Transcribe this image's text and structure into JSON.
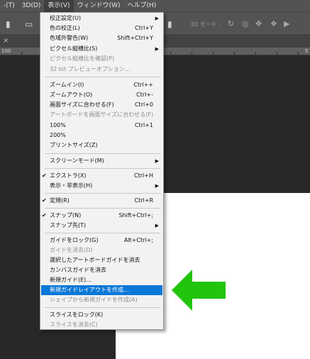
{
  "menubar": {
    "items": [
      "-(T)",
      "3D(D)",
      "表示(V)",
      "ウィンドウ(W)",
      "ヘルプ(H)"
    ]
  },
  "optionsbar": {
    "mode_label": "3D モード :"
  },
  "ruler": {
    "marks": [
      "100",
      "5"
    ]
  },
  "menu": {
    "items": [
      {
        "label": "校正設定(U)",
        "shortcut": "",
        "submenu": true,
        "checked": false,
        "disabled": false
      },
      {
        "label": "色の校正(L)",
        "shortcut": "Ctrl+Y",
        "submenu": false,
        "checked": false,
        "disabled": false
      },
      {
        "label": "色域外警告(W)",
        "shortcut": "Shift+Ctrl+Y",
        "submenu": false,
        "checked": false,
        "disabled": false
      },
      {
        "label": "ピクセル縦横比(S)",
        "shortcut": "",
        "submenu": true,
        "checked": false,
        "disabled": false
      },
      {
        "label": "ピクセル縦横比を確認(P)",
        "shortcut": "",
        "submenu": false,
        "checked": false,
        "disabled": true
      },
      {
        "label": "32 bit プレビューオプション...",
        "shortcut": "",
        "submenu": false,
        "checked": false,
        "disabled": true
      },
      {
        "label": "ズームイン(I)",
        "shortcut": "Ctrl++",
        "submenu": false,
        "checked": false,
        "disabled": false
      },
      {
        "label": "ズームアウト(O)",
        "shortcut": "Ctrl+-",
        "submenu": false,
        "checked": false,
        "disabled": false
      },
      {
        "label": "画面サイズに合わせる(F)",
        "shortcut": "Ctrl+0",
        "submenu": false,
        "checked": false,
        "disabled": false
      },
      {
        "label": "アートボードを画面サイズに合わせる(F)",
        "shortcut": "",
        "submenu": false,
        "checked": false,
        "disabled": true
      },
      {
        "label": "100%",
        "shortcut": "Ctrl+1",
        "submenu": false,
        "checked": false,
        "disabled": false
      },
      {
        "label": "200%",
        "shortcut": "",
        "submenu": false,
        "checked": false,
        "disabled": false
      },
      {
        "label": "プリントサイズ(Z)",
        "shortcut": "",
        "submenu": false,
        "checked": false,
        "disabled": false
      },
      {
        "label": "スクリーンモード(M)",
        "shortcut": "",
        "submenu": true,
        "checked": false,
        "disabled": false
      },
      {
        "label": "エクストラ(X)",
        "shortcut": "Ctrl+H",
        "submenu": false,
        "checked": true,
        "disabled": false
      },
      {
        "label": "表示・非表示(H)",
        "shortcut": "",
        "submenu": true,
        "checked": false,
        "disabled": false
      },
      {
        "label": "定規(R)",
        "shortcut": "Ctrl+R",
        "submenu": false,
        "checked": true,
        "disabled": false
      },
      {
        "label": "スナップ(N)",
        "shortcut": "Shift+Ctrl+;",
        "submenu": false,
        "checked": true,
        "disabled": false
      },
      {
        "label": "スナップ先(T)",
        "shortcut": "",
        "submenu": true,
        "checked": false,
        "disabled": false
      },
      {
        "label": "ガイドをロック(G)",
        "shortcut": "Alt+Ctrl+;",
        "submenu": false,
        "checked": false,
        "disabled": false
      },
      {
        "label": "ガイドを消去(D)",
        "shortcut": "",
        "submenu": false,
        "checked": false,
        "disabled": true
      },
      {
        "label": "選択したアートボードガイドを消去",
        "shortcut": "",
        "submenu": false,
        "checked": false,
        "disabled": false
      },
      {
        "label": "カンバスガイドを消去",
        "shortcut": "",
        "submenu": false,
        "checked": false,
        "disabled": false
      },
      {
        "label": "新規ガイド(E)...",
        "shortcut": "",
        "submenu": false,
        "checked": false,
        "disabled": false
      },
      {
        "label": "新規ガイドレイアウトを作成...",
        "shortcut": "",
        "submenu": false,
        "checked": false,
        "disabled": false,
        "highlighted": true
      },
      {
        "label": "シェイプから新規ガイドを作成(A)",
        "shortcut": "",
        "submenu": false,
        "checked": false,
        "disabled": true
      },
      {
        "label": "スライスをロック(K)",
        "shortcut": "",
        "submenu": false,
        "checked": false,
        "disabled": false
      },
      {
        "label": "スライスを消去(C)",
        "shortcut": "",
        "submenu": false,
        "checked": false,
        "disabled": true
      }
    ]
  },
  "colors": {
    "highlight": "#0a78d7",
    "arrow": "#22c40e"
  }
}
